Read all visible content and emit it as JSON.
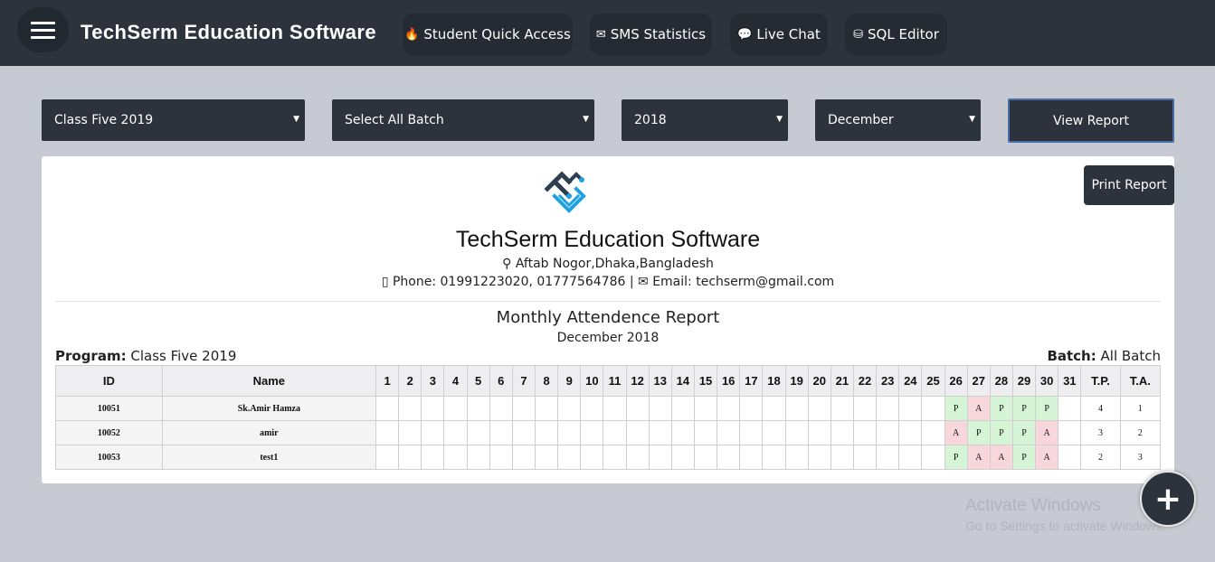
{
  "header": {
    "brand": "TechSerm Education Software",
    "nav": [
      {
        "label": "Student Quick Access",
        "icon": "fire-icon"
      },
      {
        "label": "SMS Statistics",
        "icon": "envelope-icon"
      },
      {
        "label": "Live Chat",
        "icon": "chat-icon"
      },
      {
        "label": "SQL Editor",
        "icon": "database-icon"
      }
    ]
  },
  "filters": {
    "class": "Class Five 2019",
    "batch": "Select All Batch",
    "year": "2018",
    "month": "December",
    "view_label": "View Report"
  },
  "report": {
    "print_label": "Print Report",
    "org_name": "TechSerm Education Software",
    "address": "Aftab Nogor,Dhaka,Bangladesh",
    "phone": "Phone: 01991223020, 01777564786",
    "separator": "|",
    "email": "Email: techserm@gmail.com",
    "title": "Monthly Attendence Report",
    "period": "December 2018",
    "program_label": "Program:",
    "program_value": "Class Five 2019",
    "batch_label": "Batch:",
    "batch_value": "All Batch",
    "columns": {
      "id": "ID",
      "name": "Name",
      "days": [
        "1",
        "2",
        "3",
        "4",
        "5",
        "6",
        "7",
        "8",
        "9",
        "10",
        "11",
        "12",
        "13",
        "14",
        "15",
        "16",
        "17",
        "18",
        "19",
        "20",
        "21",
        "22",
        "23",
        "24",
        "25",
        "26",
        "27",
        "28",
        "29",
        "30",
        "31"
      ],
      "tp": "T.P.",
      "ta": "T.A."
    },
    "rows": [
      {
        "id": "10051",
        "name": "Sk.Amir Hamza",
        "marks": {
          "26": "P",
          "27": "A",
          "28": "P",
          "29": "P",
          "30": "P"
        },
        "tp": "4",
        "ta": "1"
      },
      {
        "id": "10052",
        "name": "amir",
        "marks": {
          "26": "A",
          "27": "P",
          "28": "P",
          "29": "P",
          "30": "A"
        },
        "tp": "3",
        "ta": "2"
      },
      {
        "id": "10053",
        "name": "test1",
        "marks": {
          "26": "P",
          "27": "A",
          "28": "A",
          "29": "P",
          "30": "A"
        },
        "tp": "2",
        "ta": "3"
      }
    ]
  },
  "watermark": {
    "line1": "Activate Windows",
    "line2": "Go to Settings to activate Windows."
  },
  "fab": {
    "label": "+"
  },
  "colors": {
    "present": "#d6f5d6",
    "absent": "#f7d6dc",
    "topbar": "#2d333c"
  }
}
